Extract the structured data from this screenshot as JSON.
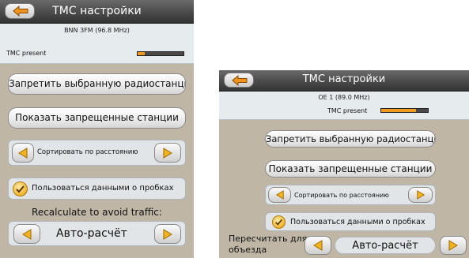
{
  "screen_a": {
    "title": "TMC настройки",
    "station": "BNN 3FM (96.8 MHz)",
    "tmc_label": "TMC present",
    "tmc_level": 0.15,
    "block_station_label": "Запретить выбранную радиостанцию",
    "show_blocked_label": "Показать запрещенные станции",
    "sort_label": "Сортировать по расстоянию",
    "use_traffic_label": "Пользоваться данными о пробках",
    "recalc_label": "Recalculate to avoid traffic:",
    "recalc_value": "Авто-расчёт"
  },
  "screen_b": {
    "title": "TMC настройки",
    "station": "OE 1 (89.0 MHz)",
    "tmc_label": "TMC present",
    "tmc_level": 0.75,
    "block_station_label": "Запретить выбранную радиостанцию",
    "show_blocked_label": "Показать запрещенные станции",
    "sort_label": "Сортировать по расстоянию",
    "use_traffic_label": "Пользоваться данными о пробках",
    "recalc_label_line1": "Пересчитать для",
    "recalc_label_line2": "объезда",
    "recalc_value": "Авто-расчёт"
  },
  "colors": {
    "accent": "#f09a1e",
    "titlebar": "#4a4a4a",
    "background": "#bfb6a6"
  },
  "icons": {
    "back": "back-arrow-icon",
    "left": "arrow-left-icon",
    "right": "arrow-right-icon",
    "check": "checkmark-icon"
  }
}
